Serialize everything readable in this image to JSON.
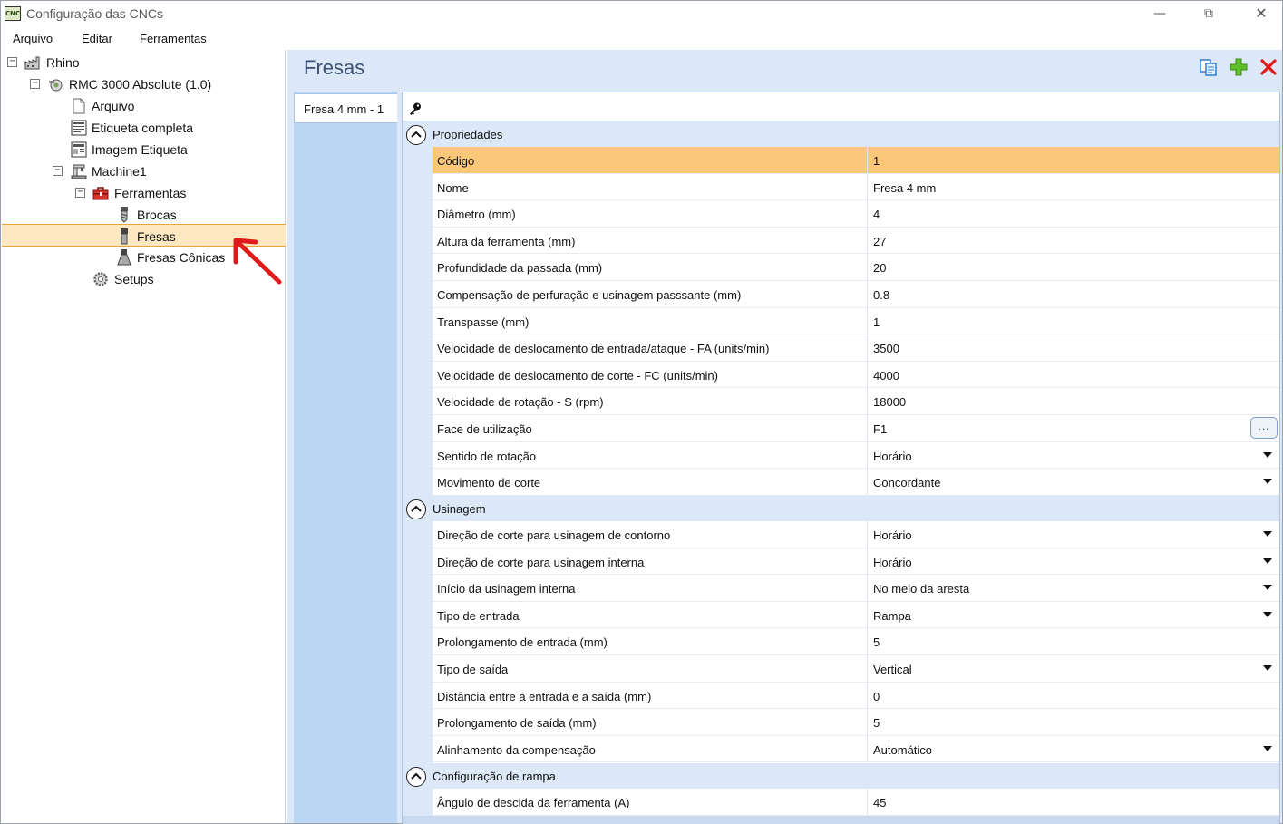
{
  "window": {
    "title": "Configuração das CNCs",
    "app_icon_text": "CNC",
    "controls": {
      "minimize": "—",
      "maximize": "⧉",
      "close": "✕"
    }
  },
  "menu": [
    "Arquivo",
    "Editar",
    "Ferramentas"
  ],
  "tree": [
    {
      "label": "Rhino",
      "toggle": "−",
      "icon": "factory-icon"
    },
    {
      "label": "RMC 3000 Absolute (1.0)",
      "toggle": "−",
      "icon": "machine-gear-icon"
    },
    {
      "label": "Arquivo",
      "icon": "document-icon"
    },
    {
      "label": "Etiqueta completa",
      "icon": "label-icon"
    },
    {
      "label": "Imagem Etiqueta",
      "icon": "image-label-icon"
    },
    {
      "label": "Machine1",
      "toggle": "−",
      "icon": "machine-icon"
    },
    {
      "label": "Ferramentas",
      "toggle": "−",
      "icon": "toolbox-icon"
    },
    {
      "label": "Brocas",
      "icon": "drill-bit-icon"
    },
    {
      "label": "Fresas",
      "icon": "end-mill-icon",
      "selected": true
    },
    {
      "label": "Fresas Cônicas",
      "icon": "conical-mill-icon"
    },
    {
      "label": "Setups",
      "icon": "settings-gear-icon"
    }
  ],
  "main": {
    "title": "Fresas",
    "tabs": [
      "Fresa 4 mm - 1"
    ],
    "groups": {
      "propriedades": "Propriedades",
      "usinagem": "Usinagem",
      "rampa": "Configuração de rampa"
    },
    "ellipsis": "...",
    "properties": [
      {
        "name": "Código",
        "value": "1",
        "selected": true
      },
      {
        "name": "Nome",
        "value": "Fresa 4 mm"
      },
      {
        "name": "Diâmetro (mm)",
        "value": "4"
      },
      {
        "name": "Altura da ferramenta (mm)",
        "value": "27"
      },
      {
        "name": "Profundidade da passada (mm)",
        "value": "20"
      },
      {
        "name": "Compensação de perfuração e usinagem passsante (mm)",
        "value": "0.8"
      },
      {
        "name": "Transpasse (mm)",
        "value": "1"
      },
      {
        "name": "Velocidade de deslocamento de entrada/ataque - FA (units/min)",
        "value": "3500"
      },
      {
        "name": "Velocidade de deslocamento de corte - FC (units/min)",
        "value": "4000"
      },
      {
        "name": "Velocidade de rotação - S (rpm)",
        "value": "18000"
      },
      {
        "name": "Face de utilização",
        "value": "F1",
        "editor": "ellipsis"
      },
      {
        "name": "Sentido de rotação",
        "value": "Horário",
        "editor": "dropdown"
      },
      {
        "name": "Movimento de corte",
        "value": "Concordante",
        "editor": "dropdown"
      }
    ],
    "usinagem": [
      {
        "name": "Direção de corte para usinagem de contorno",
        "value": "Horário",
        "editor": "dropdown"
      },
      {
        "name": "Direção de corte para usinagem interna",
        "value": "Horário",
        "editor": "dropdown"
      },
      {
        "name": "Início da usinagem interna",
        "value": "No meio da aresta",
        "editor": "dropdown"
      },
      {
        "name": "Tipo de entrada",
        "value": "Rampa",
        "editor": "dropdown"
      },
      {
        "name": "Prolongamento de entrada (mm)",
        "value": "5"
      },
      {
        "name": "Tipo de saída",
        "value": "Vertical",
        "editor": "dropdown"
      },
      {
        "name": "Distância entre a entrada e a saída (mm)",
        "value": "0"
      },
      {
        "name": "Prolongamento de saída (mm)",
        "value": "5"
      },
      {
        "name": "Alinhamento da compensação",
        "value": "Automático",
        "editor": "dropdown"
      }
    ],
    "rampa": [
      {
        "name": "Ângulo de descida da ferramenta (A)",
        "value": "45"
      }
    ]
  },
  "colors": {
    "selection": "#fbc879",
    "tree_selection": "#fde8c1",
    "group_bg": "#dce8f7",
    "title": "#3b5173",
    "arrow": "#e01b1b"
  }
}
